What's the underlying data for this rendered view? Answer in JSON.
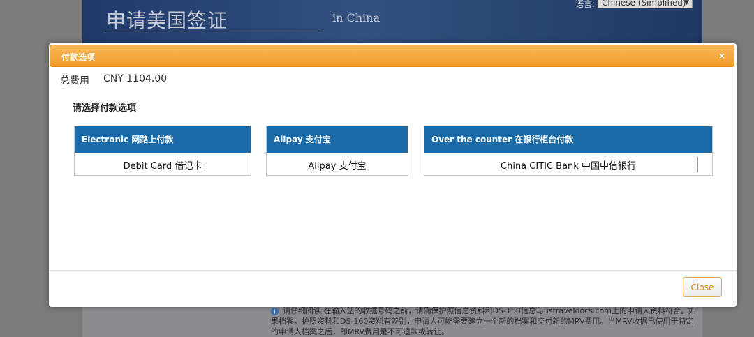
{
  "background": {
    "title": "申请美国签证",
    "subtitle": "in China",
    "language_label": "语言:",
    "language_value": "Chinese (Simplified)",
    "notice": "请仔细阅读 在输入您的收据号码之前，请确保护照信息资料和DS-160信息与ustraveldocs.com上的申请人资料符合。如果档案，护照资料和DS-160资料有差别，申请人可能需要建立一个新的档案和交付新的MRV费用。当MRV收据已使用于特定的申请人档案之后，即MRV费用是不可退款或转让。"
  },
  "modal": {
    "title": "付款选项",
    "close_icon": "×",
    "total_label": "总费用",
    "total_value": "CNY 1104.00",
    "prompt": "请选择付款选项",
    "options": [
      {
        "header": "Electronic 网路上付款",
        "link": "Debit Card 借记卡"
      },
      {
        "header": "Alipay 支付宝",
        "link": "Alipay 支付宝"
      },
      {
        "header": "Over the counter 在银行柜台付款",
        "link": "China CITIC Bank 中国中信银行"
      }
    ],
    "close_button": "Close"
  },
  "colors": {
    "header_orange": "#f29b2a",
    "option_header_blue": "#1b6aa8",
    "overlay_gray": "#7b7b7b"
  }
}
